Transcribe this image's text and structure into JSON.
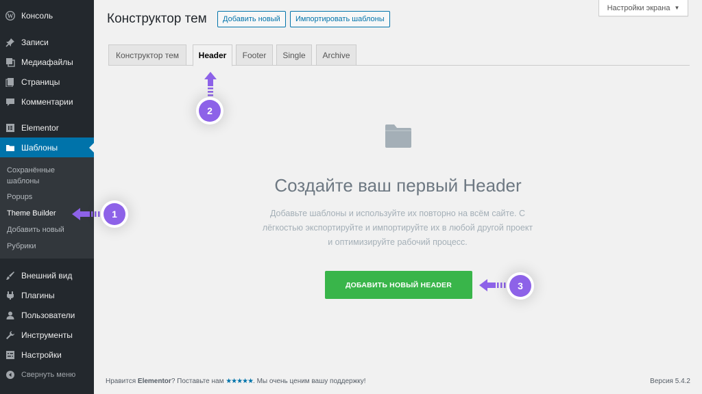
{
  "sidebar": {
    "items": [
      {
        "label": "Консоль",
        "icon": "wordpress-icon"
      },
      {
        "label": "Записи",
        "icon": "pin-icon"
      },
      {
        "label": "Медиафайлы",
        "icon": "media-icon"
      },
      {
        "label": "Страницы",
        "icon": "pages-icon"
      },
      {
        "label": "Комментарии",
        "icon": "comment-icon"
      },
      {
        "label": "Elementor",
        "icon": "elementor-icon"
      },
      {
        "label": "Шаблоны",
        "icon": "folder-icon"
      },
      {
        "label": "Внешний вид",
        "icon": "brush-icon"
      },
      {
        "label": "Плагины",
        "icon": "plugin-icon"
      },
      {
        "label": "Пользователи",
        "icon": "user-icon"
      },
      {
        "label": "Инструменты",
        "icon": "wrench-icon"
      },
      {
        "label": "Настройки",
        "icon": "settings-icon"
      }
    ],
    "submenu": [
      {
        "label": "Сохранённые шаблоны"
      },
      {
        "label": "Popups"
      },
      {
        "label": "Theme Builder"
      },
      {
        "label": "Добавить новый"
      },
      {
        "label": "Рубрики"
      }
    ],
    "collapse_label": "Свернуть меню"
  },
  "header": {
    "title": "Конструктор тем",
    "add_new_label": "Добавить новый",
    "import_label": "Импортировать шаблоны",
    "screen_options_label": "Настройки экрана"
  },
  "tabs": [
    {
      "label": "Конструктор тем"
    },
    {
      "label": "Header"
    },
    {
      "label": "Footer"
    },
    {
      "label": "Single"
    },
    {
      "label": "Archive"
    }
  ],
  "empty_state": {
    "title": "Создайте ваш первый Header",
    "description_lines": [
      "Добавьте шаблоны и используйте их повторно на всём сайте. С",
      "лёгкостью экспортируйте и импортируйте их в любой другой проект",
      "и оптимизируйте рабочий процесс."
    ],
    "button_label": "ДОБАВИТЬ НОВЫЙ HEADER"
  },
  "footer": {
    "text_before": "Нравится ",
    "brand": "Elementor",
    "text_middle": "? Поставьте нам ",
    "stars": "★★★★★",
    "text_after": ". Мы очень ценим вашу поддержку!",
    "version": "Версия 5.4.2"
  },
  "annotations": [
    {
      "number": "1"
    },
    {
      "number": "2"
    },
    {
      "number": "3"
    }
  ],
  "colors": {
    "sidebar_bg": "#23282d",
    "active_blue": "#0073aa",
    "button_green": "#39b54a",
    "badge_purple": "#8d62e8"
  }
}
